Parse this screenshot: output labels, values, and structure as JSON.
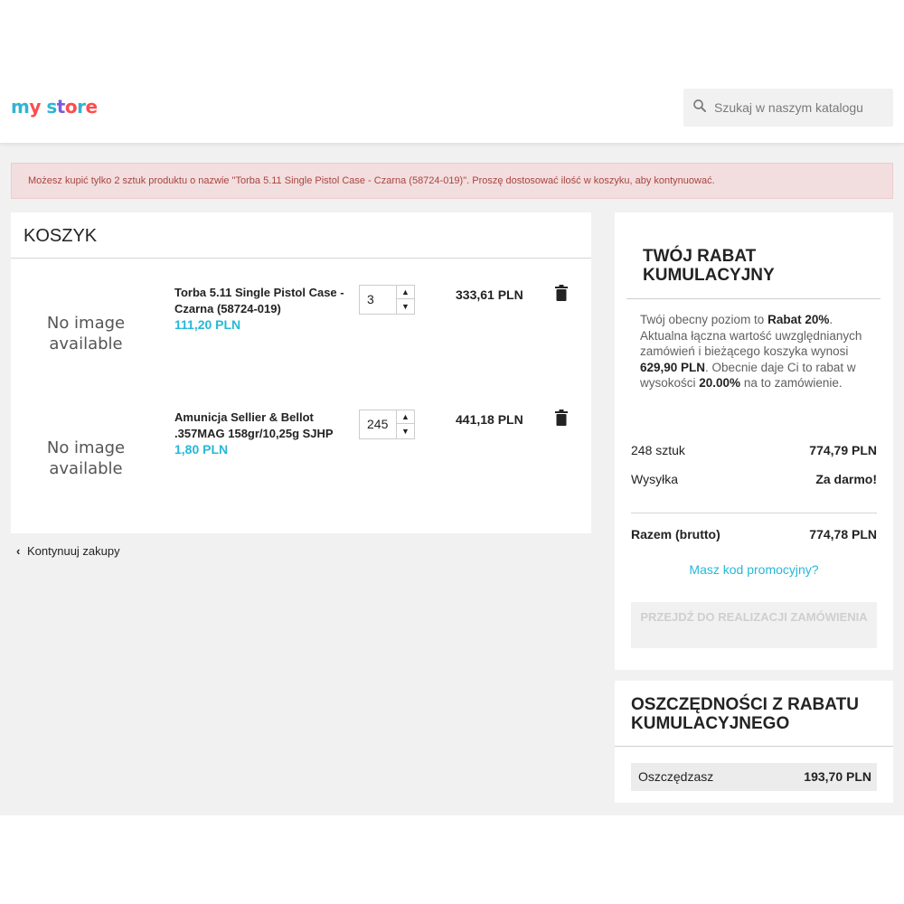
{
  "brand": {
    "logo_chars": [
      {
        "ch": "m",
        "color": "#2fb5d2"
      },
      {
        "ch": "y",
        "color": "#ff4c4c"
      },
      {
        "ch": " ",
        "color": "#ffffff"
      },
      {
        "ch": "s",
        "color": "#2fb5d2"
      },
      {
        "ch": "t",
        "color": "#7a5ce0"
      },
      {
        "ch": "o",
        "color": "#ff4c4c"
      },
      {
        "ch": "r",
        "color": "#2fb5d2"
      },
      {
        "ch": "e",
        "color": "#ff4c4c"
      }
    ]
  },
  "search": {
    "placeholder": "Szukaj w naszym katalogu",
    "icon": "search-icon"
  },
  "alert": {
    "text": "Możesz kupić tylko 2 sztuk produktu o nazwie \"Torba 5.11 Single Pistol Case - Czarna (58724-019)\". Proszę dostosować ilość w koszyku, aby kontynuować."
  },
  "cart": {
    "title": "KOSZYK",
    "items": [
      {
        "image_text": "No image available",
        "name": "Torba 5.11 Single Pistol Case - Czarna (58724-019)",
        "unit_price": "111,20 PLN",
        "quantity": "3",
        "line_total": "333,61 PLN"
      },
      {
        "image_text": "No image available",
        "name": "Amunicja Sellier & Bellot .357MAG 158gr/10,25g SJHP",
        "unit_price": "1,80 PLN",
        "quantity": "245",
        "line_total": "441,18 PLN"
      }
    ],
    "continue_label": "Kontynuuj zakupy"
  },
  "summary": {
    "rabat_title": "TWÓJ RABAT KUMULACYJNY",
    "rabat_desc": {
      "p1": "Twój obecny poziom to ",
      "b1": "Rabat 20%",
      "p2": ". Aktualna łączna wartość uwzględnianych zamówień i bieżącego koszyka wynosi ",
      "b2": "629,90 PLN",
      "p3": ". Obecnie daje Ci to rabat w wysokości ",
      "b3": "20.00%",
      "p4": " na to zamówienie."
    },
    "items_label": "248 sztuk",
    "items_value": "774,79 PLN",
    "shipping_label": "Wysyłka",
    "shipping_value": "Za darmo!",
    "total_label": "Razem (brutto)",
    "total_value": "774,78 PLN",
    "promo_link": "Masz kod promocyjny?",
    "checkout_label": "PRZEJDŹ DO REALIZACJI ZAMÓWIENIA"
  },
  "savings": {
    "title": "OSZCZĘDNOŚCI Z RABATU KUMULACYJNEGO",
    "label": "Oszczędzasz",
    "value": "193,70 PLN"
  },
  "colors": {
    "accent": "#24b9d7",
    "alert_bg": "#f2dede",
    "alert_text": "#a94442",
    "page_bg": "#f1f1f1"
  }
}
